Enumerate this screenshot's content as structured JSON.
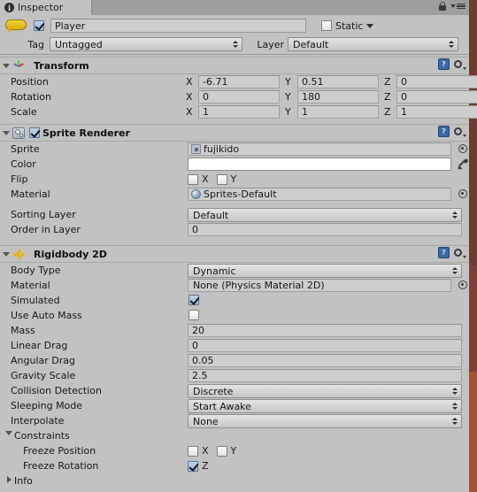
{
  "window": {
    "tab_label": "Inspector",
    "tab_icon": "info-circle-icon",
    "lock_icon": "lock-icon",
    "menu_icon": "hamburger-menu-icon"
  },
  "object_header": {
    "enabled": true,
    "icon": "gameobject-icon",
    "name": "Player",
    "name_placeholder": "Name",
    "static_label": "Static",
    "static_checked": false,
    "tag_label": "Tag",
    "tag_value": "Untagged",
    "layer_label": "Layer",
    "layer_value": "Default"
  },
  "components": [
    {
      "name": "Transform",
      "icon": "transform-axis-icon",
      "expanded": true,
      "has_enable_toggle": false,
      "rows": [
        {
          "label": "Position",
          "type": "vector3",
          "x": "-6.71",
          "y": "0.51",
          "z": "0"
        },
        {
          "label": "Rotation",
          "type": "vector3",
          "x": "0",
          "y": "180",
          "z": "0"
        },
        {
          "label": "Scale",
          "type": "vector3",
          "x": "1",
          "y": "1",
          "z": "1"
        }
      ]
    },
    {
      "name": "Sprite Renderer",
      "icon": "sprite-renderer-icon",
      "expanded": true,
      "has_enable_toggle": true,
      "enabled": true,
      "rows": [
        {
          "label": "Sprite",
          "type": "object",
          "value": "fujikido",
          "thumb": "sprite-thumb-icon"
        },
        {
          "label": "Color",
          "type": "color",
          "value": "#ffffff"
        },
        {
          "label": "Flip",
          "type": "checkgroup",
          "items": [
            {
              "label": "X",
              "checked": false
            },
            {
              "label": "Y",
              "checked": false
            }
          ]
        },
        {
          "label": "Material",
          "type": "object",
          "value": "Sprites-Default",
          "thumb": "material-sphere-icon"
        },
        {
          "label": "Sorting Layer",
          "type": "dropdown",
          "value": "Default"
        },
        {
          "label": "Order in Layer",
          "type": "text",
          "value": "0"
        }
      ]
    },
    {
      "name": "Rigidbody 2D",
      "icon": "rigidbody-2d-icon",
      "expanded": true,
      "has_enable_toggle": false,
      "rows": [
        {
          "label": "Body Type",
          "type": "dropdown",
          "value": "Dynamic"
        },
        {
          "label": "Material",
          "type": "object",
          "value": "None (Physics Material 2D)",
          "thumb": "none-icon"
        },
        {
          "label": "Simulated",
          "type": "checkbox",
          "checked": true
        },
        {
          "label": "Use Auto Mass",
          "type": "checkbox",
          "checked": false
        },
        {
          "label": "Mass",
          "type": "text",
          "value": "20"
        },
        {
          "label": "Linear Drag",
          "type": "text",
          "value": "0"
        },
        {
          "label": "Angular Drag",
          "type": "text",
          "value": "0.05"
        },
        {
          "label": "Gravity Scale",
          "type": "text",
          "value": "2.5"
        },
        {
          "label": "Collision Detection",
          "type": "dropdown",
          "value": "Discrete"
        },
        {
          "label": "Sleeping Mode",
          "type": "dropdown",
          "value": "Start Awake"
        },
        {
          "label": "Interpolate",
          "type": "dropdown",
          "value": "None"
        },
        {
          "label": "Constraints",
          "type": "foldout",
          "expanded": true
        },
        {
          "label": "Freeze Position",
          "type": "checkgroup",
          "indent": 1,
          "items": [
            {
              "label": "X",
              "checked": false
            },
            {
              "label": "Y",
              "checked": false
            }
          ]
        },
        {
          "label": "Freeze Rotation",
          "type": "checkgroup",
          "indent": 1,
          "items": [
            {
              "label": "Z",
              "checked": true
            }
          ]
        },
        {
          "label": "Info",
          "type": "foldout",
          "expanded": false
        }
      ]
    }
  ],
  "icons": {
    "help": "help-book-icon",
    "gear": "gear-icon",
    "select": "object-picker-icon",
    "eyedropper": "eyedropper-icon"
  },
  "colors": {
    "panel_bg": "#c2c2c2",
    "field_bg": "#cdcdcd",
    "tab_bar": "#9e9e9e",
    "accent_edge": "#7a4032",
    "checkbox_on": "#a8c0de"
  }
}
